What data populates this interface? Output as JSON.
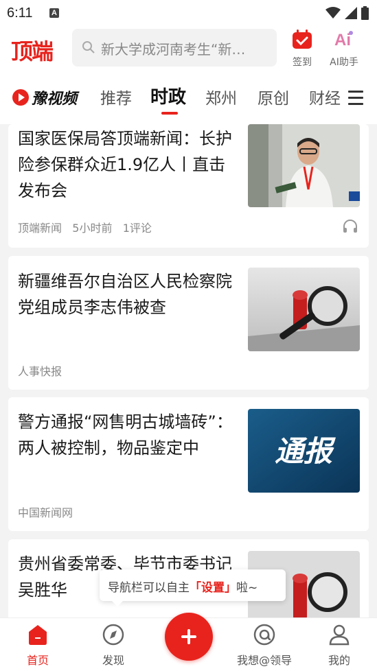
{
  "status": {
    "time": "6:11",
    "notif_icon": "A"
  },
  "header": {
    "logo": "顶端",
    "search_placeholder": "新大学成河南考生“新…",
    "sign_label": "签到",
    "ai_label": "AI助手"
  },
  "tabs": {
    "brand": "豫视频",
    "items": [
      "推荐",
      "时政",
      "郑州",
      "原创",
      "财经"
    ],
    "active": "时政"
  },
  "articles": [
    {
      "title": "国家医保局答顶端新闻：长护险参保群众近1.9亿人丨直击发布会",
      "source": "顶端新闻",
      "time": "5小时前",
      "comments": "1评论",
      "has_audio": true,
      "thumb": "speaker-photo"
    },
    {
      "title": " 新疆维吾尔自治区人民检察院党组成员李志伟被查",
      "source": "人事快报",
      "thumb": "magnifier-photo"
    },
    {
      "title": "警方通报“网售明古城墙砖”：两人被控制，物品鉴定中",
      "source": "中国新闻网",
      "thumb_text": "通报"
    },
    {
      "title": "贵州省委常委、毕节市委书记吴胜华",
      "thumb": "magnifier-photo"
    }
  ],
  "tooltip": {
    "before": "导航栏可以自主",
    "highlight": "「设置」",
    "after": "啦~"
  },
  "bottom_nav": {
    "home": "首页",
    "discover": "发现",
    "leader": "我想@领导",
    "mine": "我的"
  },
  "colors": {
    "accent": "#e8231d"
  }
}
